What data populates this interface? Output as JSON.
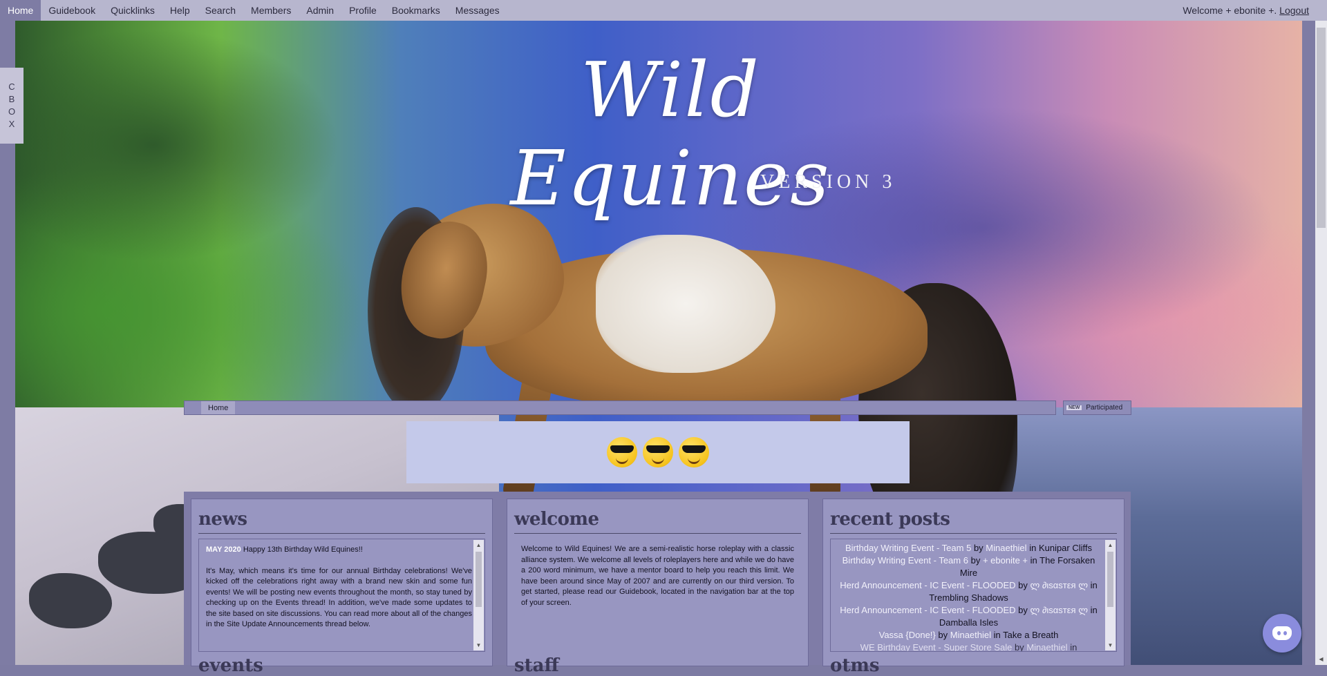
{
  "topnav": {
    "items": [
      {
        "label": "Home",
        "active": true
      },
      {
        "label": "Guidebook"
      },
      {
        "label": "Quicklinks"
      },
      {
        "label": "Help"
      },
      {
        "label": "Search"
      },
      {
        "label": "Members"
      },
      {
        "label": "Admin"
      },
      {
        "label": "Profile"
      },
      {
        "label": "Bookmarks"
      },
      {
        "label": "Messages"
      }
    ],
    "welcome_text": "Welcome + ebonite +.",
    "logout_label": "Logout"
  },
  "header": {
    "logo_title": "Wild Equines",
    "logo_subtitle": "VERSION 3"
  },
  "cbox": {
    "letters": [
      "C",
      "B",
      "O",
      "X"
    ]
  },
  "breadcrumb": {
    "home": "Home"
  },
  "participated": {
    "badge": "NEW",
    "label": "Participated"
  },
  "banner": {
    "emojis": [
      "smiling-face-with-sunglasses",
      "smiling-face-with-sunglasses",
      "smiling-face-with-sunglasses"
    ]
  },
  "panels": {
    "news": {
      "title": "news",
      "date": "MAY 2020",
      "headline": "Happy 13th Birthday Wild Equines!!",
      "body": "It's May, which means it's time for our annual Birthday celebrations! We've kicked off the celebrations right away with a brand new skin and some fun events! We will be posting new events throughout the month, so stay tuned by checking up on the Events thread! In addition, we've made some updates to the site based on site discussions. You can read more about all of the changes in the Site Update Announcements thread below.",
      "next_heading": "events"
    },
    "welcome": {
      "title": "welcome",
      "body": "Welcome to Wild Equines! We are a semi-realistic horse roleplay with a classic alliance system. We welcome all levels of roleplayers here and while we do have a 200 word minimum, we have a mentor board to help you reach this limit. We have been around since May of 2007 and are currently on our third version. To get started, please read our Guidebook, located in the navigation bar at the top of your screen.",
      "next_heading": "staff"
    },
    "recent": {
      "title": "recent posts",
      "posts": [
        {
          "topic": "Birthday Writing Event - Team 5",
          "by": "by",
          "author": "Minaethiel",
          "in": "in",
          "board": "Kunipar Cliffs"
        },
        {
          "topic": "Birthday Writing Event - Team 6",
          "by": "by",
          "author": "+ ebonite +",
          "in": "in",
          "board": "The Forsaken Mire"
        },
        {
          "topic": "Herd Announcement - IC Event - FLOODED",
          "by": "by",
          "author": "ლ ∂ιsαsтεя ლ",
          "in": "in",
          "board": "Trembling Shadows"
        },
        {
          "topic": "Herd Announcement - IC Event - FLOODED",
          "by": "by",
          "author": "ლ ∂ιsαsтεя ლ",
          "in": "in",
          "board": "Damballa Isles"
        },
        {
          "topic": "Vassa {Done!}",
          "by": "by",
          "author": "Minaethiel",
          "in": "in",
          "board": "Take a Breath"
        },
        {
          "topic": "WE Birthday Event - Super Store Sale",
          "by": "by",
          "author": "Minaethiel",
          "in": "in",
          "board": ""
        }
      ],
      "next_heading": "otms"
    }
  },
  "colors": {
    "topbar": "#b7b6ce",
    "accent": "#7e7ca4",
    "panel": "#9896c1",
    "banner": "#c4c9ea",
    "discord": "#8a8cdd"
  }
}
